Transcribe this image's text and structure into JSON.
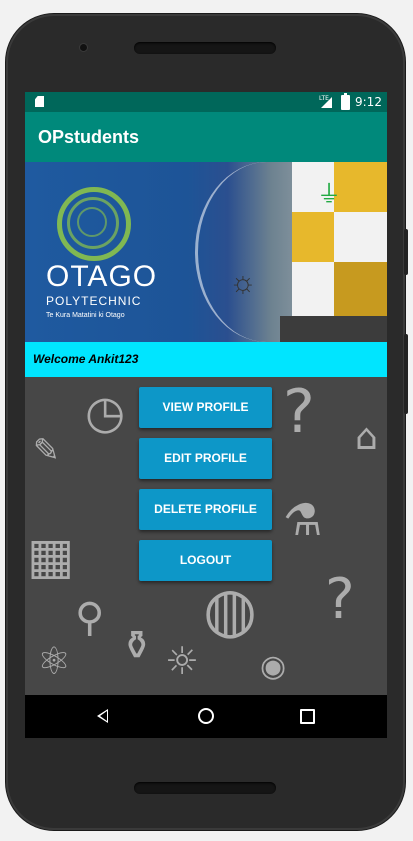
{
  "status_bar": {
    "network": "LTE",
    "time": "9:12"
  },
  "app_bar": {
    "title": "OPstudents"
  },
  "banner": {
    "logo_name": "OTAGO",
    "logo_sub": "POLYTECHNIC",
    "logo_tagline": "Te Kura Matatini ki Otago"
  },
  "welcome": {
    "text": "Welcome Ankit123"
  },
  "actions": {
    "view_profile": "VIEW PROFILE",
    "edit_profile": "EDIT PROFILE",
    "delete_profile": "DELETE PROFILE",
    "logout": "LOGOUT"
  },
  "nav_bar": {
    "back_icon": "back-icon",
    "home_icon": "home-icon",
    "recents_icon": "recents-icon"
  },
  "colors": {
    "status_bar": "#00675a",
    "app_bar": "#00897b",
    "welcome_bar": "#00e5ff",
    "button": "#0d97c8",
    "background": "#474747"
  }
}
